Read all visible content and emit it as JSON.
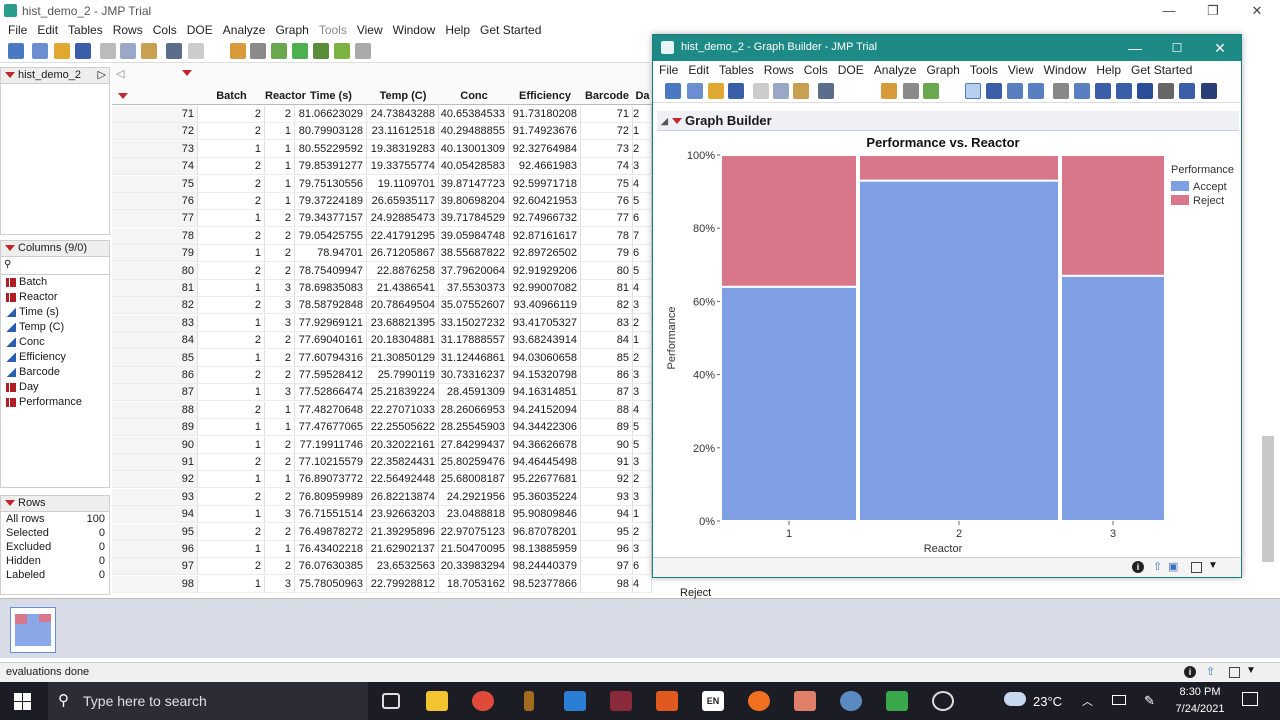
{
  "main": {
    "title": "hist_demo_2 - JMP Trial",
    "menu": [
      "File",
      "Edit",
      "Tables",
      "Rows",
      "Cols",
      "DOE",
      "Analyze",
      "Graph",
      "Tools",
      "View",
      "Window",
      "Help",
      "Get Started"
    ]
  },
  "left": {
    "table_name": "hist_demo_2",
    "columns_header": "Columns (9/0)",
    "search_placeholder": "",
    "columns": [
      {
        "name": "Batch",
        "type": "nominal"
      },
      {
        "name": "Reactor",
        "type": "nominal"
      },
      {
        "name": "Time (s)",
        "type": "continuous"
      },
      {
        "name": "Temp (C)",
        "type": "continuous"
      },
      {
        "name": "Conc",
        "type": "continuous"
      },
      {
        "name": "Efficiency",
        "type": "continuous"
      },
      {
        "name": "Barcode",
        "type": "continuous"
      },
      {
        "name": "Day",
        "type": "nominal"
      },
      {
        "name": "Performance",
        "type": "nominal"
      }
    ],
    "rows_header": "Rows",
    "row_stats": [
      {
        "label": "All rows",
        "value": "100"
      },
      {
        "label": "Selected",
        "value": "0"
      },
      {
        "label": "Excluded",
        "value": "0"
      },
      {
        "label": "Hidden",
        "value": "0"
      },
      {
        "label": "Labeled",
        "value": "0"
      }
    ]
  },
  "table": {
    "headers": [
      "",
      "Batch",
      "Reactor",
      "Time (s)",
      "Temp (C)",
      "Conc",
      "Efficiency",
      "Barcode",
      "Da"
    ],
    "rows": [
      [
        "71",
        "2",
        "2",
        "81.06623029",
        "24.73843288",
        "40.65384533",
        "91.73180208",
        "71",
        "2"
      ],
      [
        "72",
        "2",
        "1",
        "80.79903128",
        "23.11612518",
        "40.29488855",
        "91.74923676",
        "72",
        "1"
      ],
      [
        "73",
        "1",
        "1",
        "80.55229592",
        "19.38319283",
        "40.13001309",
        "92.32764984",
        "73",
        "2"
      ],
      [
        "74",
        "2",
        "1",
        "79.85391277",
        "19.33755774",
        "40.05428583",
        "92.4661983",
        "74",
        "3"
      ],
      [
        "75",
        "2",
        "1",
        "79.75130556",
        "19.1109701",
        "39.87147723",
        "92.59971718",
        "75",
        "4"
      ],
      [
        "76",
        "2",
        "1",
        "79.37224189",
        "26.65935117",
        "39.80698204",
        "92.60421953",
        "76",
        "5"
      ],
      [
        "77",
        "1",
        "2",
        "79.34377157",
        "24.92885473",
        "39.71784529",
        "92.74966732",
        "77",
        "6"
      ],
      [
        "78",
        "2",
        "2",
        "79.05425755",
        "22.41791295",
        "39.05984748",
        "92.87161617",
        "78",
        "7"
      ],
      [
        "79",
        "1",
        "2",
        "78.94701",
        "26.71205867",
        "38.55687822",
        "92.89726502",
        "79",
        "6"
      ],
      [
        "80",
        "2",
        "2",
        "78.75409947",
        "22.8876258",
        "37.79620064",
        "92.91929206",
        "80",
        "5"
      ],
      [
        "81",
        "1",
        "3",
        "78.69835083",
        "21.4386541",
        "37.5530373",
        "92.99007082",
        "81",
        "4"
      ],
      [
        "82",
        "2",
        "3",
        "78.58792848",
        "20.78649504",
        "35.07552607",
        "93.40966119",
        "82",
        "3"
      ],
      [
        "83",
        "1",
        "3",
        "77.92969121",
        "23.68821395",
        "33.15027232",
        "93.41705327",
        "83",
        "2"
      ],
      [
        "84",
        "2",
        "2",
        "77.69040161",
        "20.18304881",
        "31.17888557",
        "93.68243914",
        "84",
        "1"
      ],
      [
        "85",
        "1",
        "2",
        "77.60794316",
        "21.30850129",
        "31.12446861",
        "94.03060658",
        "85",
        "2"
      ],
      [
        "86",
        "2",
        "2",
        "77.59528412",
        "25.7990119",
        "30.73316237",
        "94.15320798",
        "86",
        "3"
      ],
      [
        "87",
        "1",
        "3",
        "77.52866474",
        "25.21839224",
        "28.4591309",
        "94.16314851",
        "87",
        "3"
      ],
      [
        "88",
        "2",
        "1",
        "77.48270648",
        "22.27071033",
        "28.26066953",
        "94.24152094",
        "88",
        "4"
      ],
      [
        "89",
        "1",
        "1",
        "77.47677065",
        "22.25505622",
        "28.25545903",
        "94.34422306",
        "89",
        "5"
      ],
      [
        "90",
        "1",
        "2",
        "77.19911746",
        "20.32022161",
        "27.84299437",
        "94.36626678",
        "90",
        "5"
      ],
      [
        "91",
        "2",
        "2",
        "77.10215579",
        "22.35824431",
        "25.80259476",
        "94.46445498",
        "91",
        "3"
      ],
      [
        "92",
        "1",
        "1",
        "76.89073772",
        "22.56492448",
        "25.68008187",
        "95.22677681",
        "92",
        "2"
      ],
      [
        "93",
        "2",
        "2",
        "76.80959989",
        "26.82213874",
        "24.2921956",
        "95.36035224",
        "93",
        "3"
      ],
      [
        "94",
        "1",
        "3",
        "76.71551514",
        "23.92663203",
        "23.0488818",
        "95.90809846",
        "94",
        "1"
      ],
      [
        "95",
        "2",
        "2",
        "76.49878272",
        "21.39295896",
        "22.97075123",
        "96.87078201",
        "95",
        "2"
      ],
      [
        "96",
        "1",
        "1",
        "76.43402218",
        "21.62902137",
        "21.50470095",
        "98.13885959",
        "96",
        "3"
      ],
      [
        "97",
        "2",
        "2",
        "76.07630385",
        "23.6532563",
        "20.33983294",
        "98.24440379",
        "97",
        "6"
      ],
      [
        "98",
        "1",
        "3",
        "75.78050963",
        "22.79928812",
        "18.7053162",
        "98.52377866",
        "98",
        "4"
      ]
    ],
    "partial_label": "Reject"
  },
  "graph_builder": {
    "title": "hist_demo_2 - Graph Builder - JMP Trial",
    "menu": [
      "File",
      "Edit",
      "Tables",
      "Rows",
      "Cols",
      "DOE",
      "Analyze",
      "Graph",
      "Tools",
      "View",
      "Window",
      "Help",
      "Get Started"
    ],
    "outline_title": "Graph Builder"
  },
  "chart_data": {
    "type": "bar",
    "stacked": "percent",
    "title": "Performance vs. Reactor",
    "xlabel": "Reactor",
    "ylabel": "Performance",
    "categories": [
      "1",
      "2",
      "3"
    ],
    "yticks": [
      "0%",
      "20%",
      "40%",
      "60%",
      "80%",
      "100%"
    ],
    "ylim": [
      0,
      100
    ],
    "legend_title": "Performance",
    "legend_placement": "right",
    "series": [
      {
        "name": "Accept",
        "values": [
          64,
          93,
          67
        ],
        "color": "#7f9fe5"
      },
      {
        "name": "Reject",
        "values": [
          36,
          7,
          33
        ],
        "color": "#d8778a"
      }
    ]
  },
  "status": {
    "text": "evaluations done"
  },
  "taskbar": {
    "search_placeholder": "Type here to search",
    "weather": "23°C",
    "time": "8:30 PM",
    "date": "7/24/2021"
  }
}
